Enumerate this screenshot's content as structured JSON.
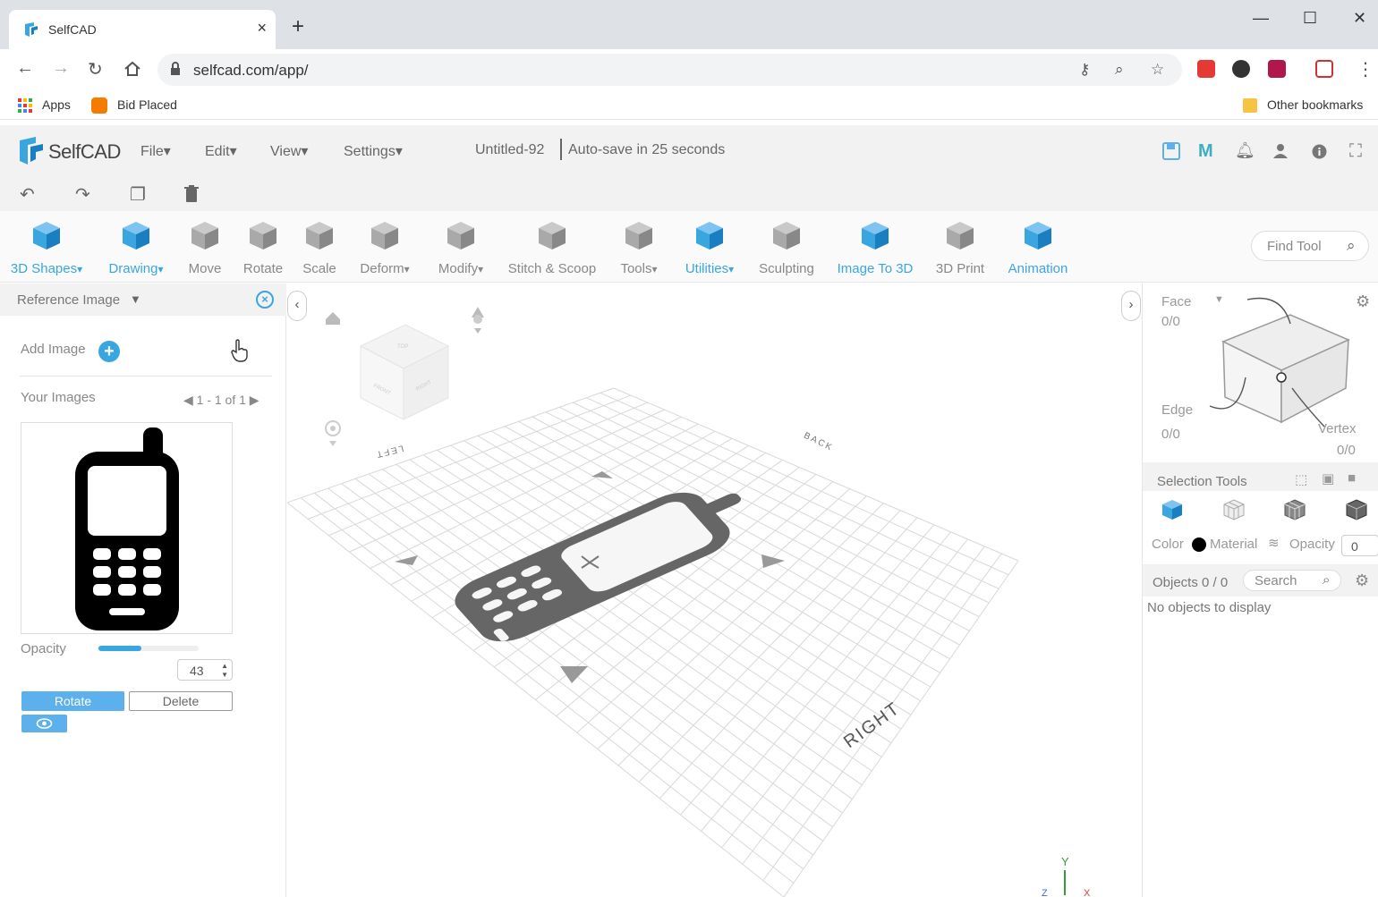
{
  "browser": {
    "tab_title": "SelfCAD",
    "tab_close": "×",
    "new_tab": "+",
    "url": "selfcad.com/app/",
    "bookmarks": {
      "apps": "Apps",
      "bid_placed": "Bid Placed",
      "other": "Other bookmarks"
    }
  },
  "app": {
    "logo_text": "SelfCAD",
    "menus": [
      "File",
      "Edit",
      "View",
      "Settings"
    ],
    "doc_title": "Untitled-92",
    "autosave": "Auto-save in 25 seconds"
  },
  "toolbar": {
    "tools": [
      {
        "label": "3D Shapes",
        "icon": "cube-icon",
        "dropdown": true,
        "active": true
      },
      {
        "label": "Drawing",
        "icon": "drawing-icon",
        "dropdown": true,
        "active": true
      },
      {
        "label": "Move",
        "icon": "move-icon",
        "dropdown": false,
        "active": false
      },
      {
        "label": "Rotate",
        "icon": "rotate-icon",
        "dropdown": false,
        "active": false
      },
      {
        "label": "Scale",
        "icon": "scale-icon",
        "dropdown": false,
        "active": false
      },
      {
        "label": "Deform",
        "icon": "deform-icon",
        "dropdown": true,
        "active": false
      },
      {
        "label": "Modify",
        "icon": "modify-icon",
        "dropdown": true,
        "active": false
      },
      {
        "label": "Stitch & Scoop",
        "icon": "stitch-scoop-icon",
        "dropdown": false,
        "active": false
      },
      {
        "label": "Tools",
        "icon": "tools-icon",
        "dropdown": true,
        "active": false
      },
      {
        "label": "Utilities",
        "icon": "utilities-icon",
        "dropdown": true,
        "active": true
      },
      {
        "label": "Sculpting",
        "icon": "sculpting-icon",
        "dropdown": false,
        "active": false
      },
      {
        "label": "Image To 3D",
        "icon": "image-to-3d-icon",
        "dropdown": false,
        "active": true
      },
      {
        "label": "3D Print",
        "icon": "3d-print-icon",
        "dropdown": false,
        "active": false
      },
      {
        "label": "Animation",
        "icon": "animation-icon",
        "dropdown": false,
        "active": true
      }
    ],
    "find_tool_placeholder": "Find Tool"
  },
  "reference_panel": {
    "title": "Reference Image",
    "add_image": "Add Image",
    "your_images": "Your Images",
    "pager": "1 - 1 of 1",
    "opacity_label": "Opacity",
    "opacity_value": "43",
    "opacity_fraction": 0.43,
    "rotate_button": "Rotate",
    "delete_button": "Delete"
  },
  "viewport": {
    "labels": {
      "left": "LEFT",
      "back": "BACK",
      "right": "RIGHT"
    },
    "cube_faces": {
      "top": "TOP",
      "front": "FRONT",
      "right": "RIGHT"
    },
    "axes": {
      "y": "Y",
      "z": "Z",
      "x": "X"
    }
  },
  "selection_panel": {
    "face_label": "Face",
    "face_count": "0/0",
    "edge_label": "Edge",
    "edge_count": "0/0",
    "vertex_label": "Vertex",
    "vertex_count": "0/0",
    "selection_tools": "Selection Tools",
    "color_label": "Color",
    "material_label": "Material",
    "opacity_label": "Opacity",
    "opacity_value": "0",
    "objects_label": "Objects 0 / 0",
    "search_placeholder": "Search",
    "empty_text": "No objects to display"
  },
  "colors": {
    "accent": "#3aa6e0",
    "button_blue": "#5cb0ec"
  }
}
